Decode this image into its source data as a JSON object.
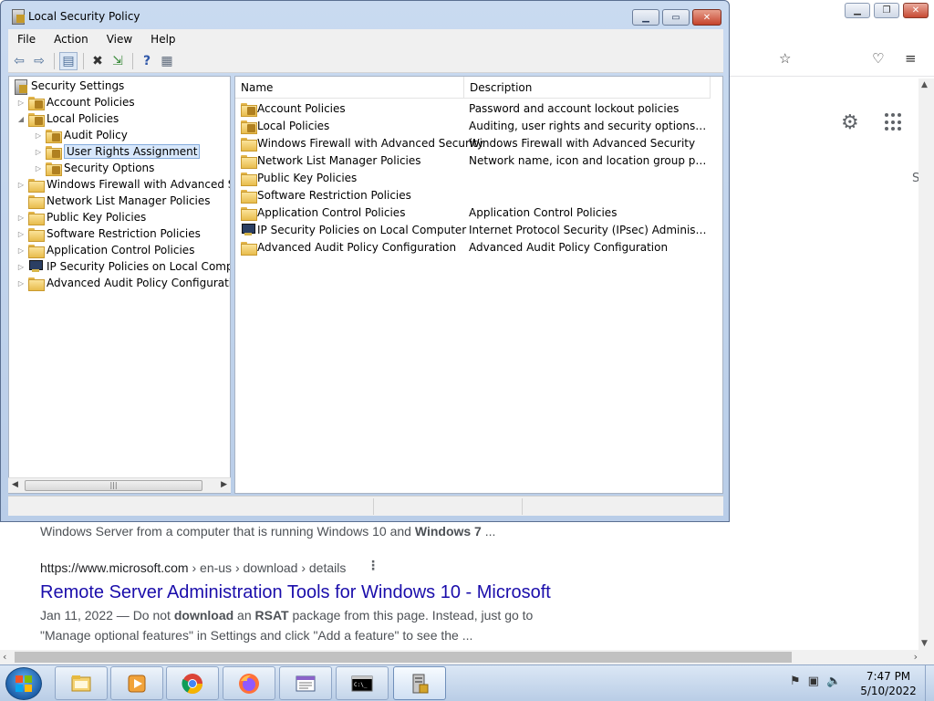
{
  "browser": {
    "snippet_top_prefix": "Windows Server from a computer that is running Windows 10 and ",
    "snippet_top_bold": "Windows 7",
    "snippet_top_suffix": " ...",
    "cite_domain": "https://www.microsoft.com",
    "cite_path": " › en-us › download › details",
    "result_title": "Remote Server Administration Tools for Windows 10 - Microsoft",
    "snip1_a": "Jan 11, 2022 — Do not ",
    "snip1_b": "download",
    "snip1_c": " an ",
    "snip1_d": "RSAT",
    "snip1_e": " package from this page. Instead, just go to",
    "snip2": "\"Manage optional features\" in Settings and click \"Add a feature\" to see the ...",
    "side_letter": "S"
  },
  "window": {
    "title": "Local Security Policy",
    "menu": [
      "File",
      "Action",
      "View",
      "Help"
    ]
  },
  "tree": {
    "root": "Security Settings",
    "items": [
      {
        "label": "Account Policies"
      },
      {
        "label": "Local Policies"
      },
      {
        "label": "Audit Policy"
      },
      {
        "label": "User Rights Assignment"
      },
      {
        "label": "Security Options"
      },
      {
        "label": "Windows Firewall with Advanced Security"
      },
      {
        "label": "Network List Manager Policies"
      },
      {
        "label": "Public Key Policies"
      },
      {
        "label": "Software Restriction Policies"
      },
      {
        "label": "Application Control Policies"
      },
      {
        "label": "IP Security Policies on Local Computer"
      },
      {
        "label": "Advanced Audit Policy Configuration"
      }
    ]
  },
  "list": {
    "columns": [
      "Name",
      "Description"
    ],
    "rows": [
      {
        "name": "Account Policies",
        "desc": "Password and account lockout policies"
      },
      {
        "name": "Local Policies",
        "desc": "Auditing, user rights and security options polici..."
      },
      {
        "name": "Windows Firewall with Advanced Security",
        "desc": "Windows Firewall with Advanced Security"
      },
      {
        "name": "Network List Manager Policies",
        "desc": "Network name, icon and location group policies."
      },
      {
        "name": "Public Key Policies",
        "desc": ""
      },
      {
        "name": "Software Restriction Policies",
        "desc": ""
      },
      {
        "name": "Application Control Policies",
        "desc": "Application Control Policies"
      },
      {
        "name": "IP Security Policies on Local Computer",
        "desc": "Internet Protocol Security (IPsec) Administratio..."
      },
      {
        "name": "Advanced Audit Policy Configuration",
        "desc": "Advanced Audit Policy Configuration"
      }
    ]
  },
  "taskbar": {
    "time": "7:47 PM",
    "date": "5/10/2022"
  }
}
